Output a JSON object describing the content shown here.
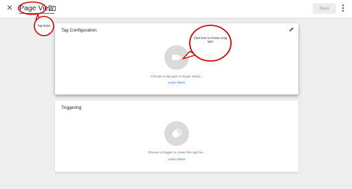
{
  "header": {
    "close_icon": "close-icon",
    "tag_name": "Page View",
    "folder_icon": "folder-icon",
    "save_label": "Save",
    "more_icon": "more-vert-icon"
  },
  "tag_configuration": {
    "title": "Tag Configuration",
    "edit_icon": "pencil-icon",
    "placeholder_icon": "tag-icon",
    "hint": "Choose a tag type to begin setup...",
    "learn_more": "Learn More"
  },
  "triggering": {
    "title": "Triggering",
    "placeholder_icon": "trigger-icon",
    "hint": "Choose a trigger to make this tag fire...",
    "learn_more": "Learn More"
  },
  "annotations": {
    "tag_name_callout": "Tag Name",
    "tag_type_callout": "Click here to choose a tag type"
  },
  "colors": {
    "accent": "#1a73e8",
    "annotation": "#d50000"
  }
}
